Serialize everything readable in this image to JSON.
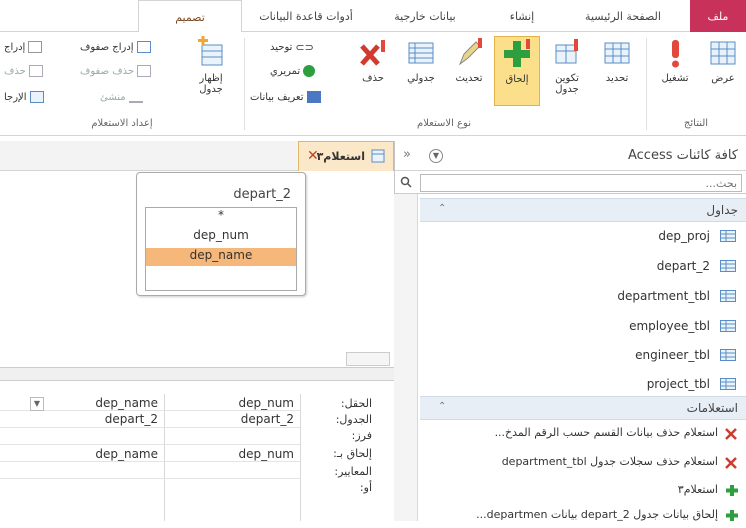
{
  "tabs": {
    "file": "ملف",
    "home": "الصفحة الرئيسية",
    "create": "إنشاء",
    "external": "بيانات خارجية",
    "dbtools": "أدوات قاعدة البيانات",
    "design": "تصميم"
  },
  "ribbon": {
    "results_group": "النتائج",
    "query_type_group": "نوع الاستعلام",
    "setup_group": "إعداد الاستعلام",
    "view": "عرض",
    "run": "تشغيل",
    "select": "تحديد",
    "make_table": "تكوين جدول",
    "append": "إلحاق",
    "update": "تحديث",
    "crosstab": "جدولي",
    "delete": "حذف",
    "union": "توحيد",
    "passthrough": "تمريري",
    "data_definition": "تعريف بيانات",
    "show_table": "إظهار جدول",
    "insert_rows": "إدراج صفوف",
    "delete_rows": "حذف صفوف",
    "builder": "منشئ",
    "insert_cols": "إدراج",
    "delete_cols": "حذف",
    "return": "الإرجا"
  },
  "nav": {
    "title": "كافة كائنات Access",
    "search_placeholder": "بحث...",
    "tables_header": "جداول",
    "queries_header": "استعلامات",
    "tables": [
      "dep_proj",
      "depart_2",
      "department_tbl",
      "employee_tbl",
      "engineer_tbl",
      "project_tbl"
    ],
    "queries": [
      "استعلام حذف بيانات القسم حسب الرقم المدخ...",
      "استعلام حذف سجلات جدول department_tbl",
      "استعلام٣",
      "إلحاق بيانات جدول depart_2 بيانات departmen..."
    ]
  },
  "designer": {
    "tab_label": "استعلام٣",
    "field_list_title": "depart_2",
    "fields": [
      "*",
      "dep_num",
      "dep_name"
    ],
    "row_labels": [
      "الحقل:",
      "الجدول:",
      "فرز:",
      "إلحاق بـ:",
      "المعايير:",
      "أو:"
    ],
    "columns": [
      {
        "field": "dep_num",
        "table": "depart_2",
        "append_to": "dep_num"
      },
      {
        "field": "dep_name",
        "table": "depart_2",
        "append_to": "dep_name"
      }
    ]
  },
  "colors": {
    "file_tab": "#c8325a",
    "selected": "#fbdf8a",
    "field_selected": "#f6b77a"
  }
}
